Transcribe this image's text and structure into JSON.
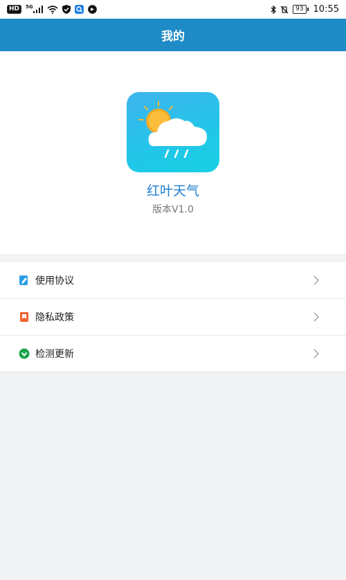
{
  "statusbar": {
    "hd": "HD",
    "network": "5G",
    "battery": "93",
    "time": "10:55"
  },
  "header": {
    "title": "我的"
  },
  "app": {
    "name": "红叶天气",
    "version": "版本V1.0"
  },
  "menu": {
    "items": [
      {
        "label": "使用协议",
        "icon": "document-edit-icon",
        "color": "#2a9ee6"
      },
      {
        "label": "隐私政策",
        "icon": "bookmark-icon",
        "color": "#f0642d"
      },
      {
        "label": "检测更新",
        "icon": "check-circle-icon",
        "color": "#1aa34a"
      }
    ]
  },
  "colors": {
    "header": "#1e8bc7",
    "accent": "#1c7fd0",
    "background": "#f2f3f5"
  }
}
